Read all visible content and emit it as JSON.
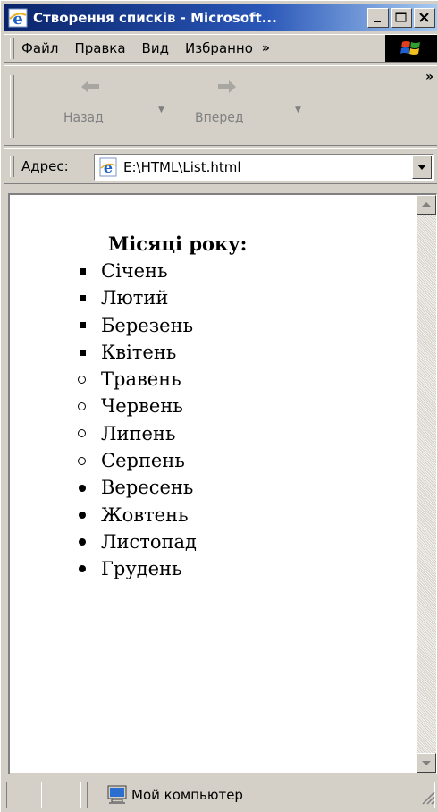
{
  "window": {
    "title": "Створення списків - Microsoft..."
  },
  "menu": {
    "items": [
      "Файл",
      "Правка",
      "Вид",
      "Избранно"
    ],
    "overflow": "»"
  },
  "toolbar": {
    "back_label": "Назад",
    "forward_label": "Вперед",
    "overflow": "»"
  },
  "address": {
    "label": "Адрес:",
    "value": "E:\\HTML\\List.html"
  },
  "page": {
    "heading": "Місяці року:",
    "months": [
      {
        "name": "Січень",
        "marker": "square"
      },
      {
        "name": "Лютий",
        "marker": "square"
      },
      {
        "name": "Березень",
        "marker": "square"
      },
      {
        "name": "Квітень",
        "marker": "square"
      },
      {
        "name": "Травень",
        "marker": "circle"
      },
      {
        "name": "Червень",
        "marker": "circle"
      },
      {
        "name": "Липень",
        "marker": "circle"
      },
      {
        "name": "Серпень",
        "marker": "circle"
      },
      {
        "name": "Вересень",
        "marker": "disc"
      },
      {
        "name": "Жовтень",
        "marker": "disc"
      },
      {
        "name": "Листопад",
        "marker": "disc"
      },
      {
        "name": "Грудень",
        "marker": "disc"
      }
    ]
  },
  "status": {
    "zone": "Мой компьютер",
    "zone_icon": "computer-icon"
  },
  "colors": {
    "titlebar_start": "#0a246a",
    "titlebar_end": "#a6caf0",
    "chrome": "#d4d0c8"
  }
}
